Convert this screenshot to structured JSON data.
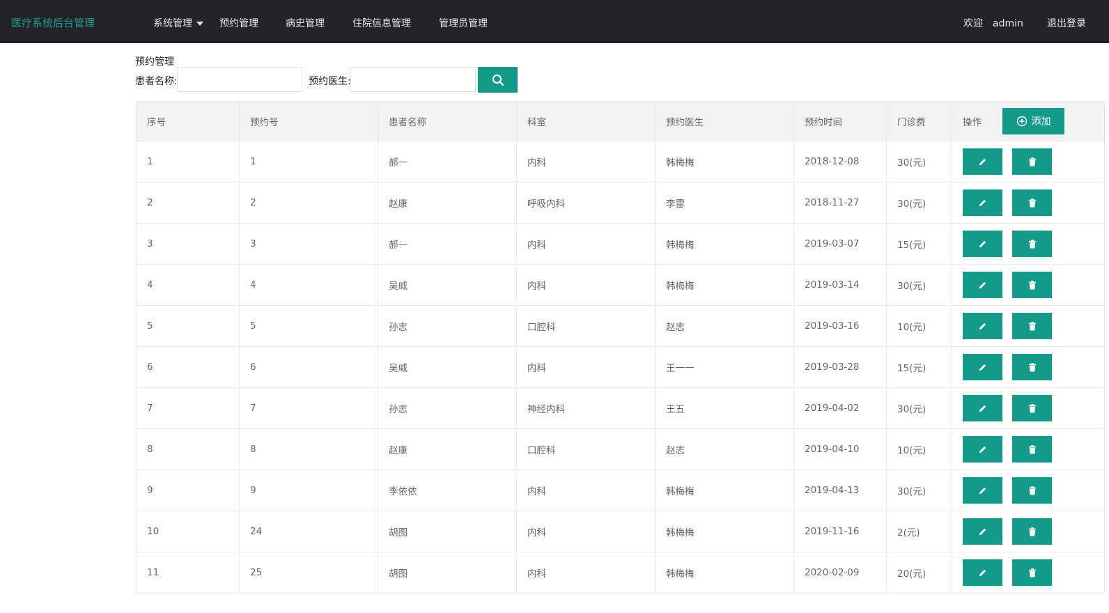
{
  "navbar": {
    "brand": "医疗系统后台管理",
    "menu": [
      {
        "label": "系统管理",
        "has_dropdown": true
      },
      {
        "label": "预约管理"
      },
      {
        "label": "病史管理"
      },
      {
        "label": "住院信息管理"
      },
      {
        "label": "管理员管理"
      }
    ],
    "welcome": "欢迎",
    "username": "admin",
    "logout": "退出登录"
  },
  "page": {
    "section_title": "预约管理",
    "filters": {
      "patient_label": "患者名称:",
      "patient_value": "",
      "doctor_label": "预约医生:",
      "doctor_value": ""
    }
  },
  "table": {
    "headers": [
      "序号",
      "预约号",
      "患者名称",
      "科室",
      "预约医生",
      "预约时间",
      "门诊费",
      "操作"
    ],
    "add_label": "添加",
    "rows": [
      [
        "1",
        "1",
        "郝一",
        "内科",
        "韩梅梅",
        "2018-12-08",
        "30(元)"
      ],
      [
        "2",
        "2",
        "赵康",
        "呼吸内科",
        "李雷",
        "2018-11-27",
        "30(元)"
      ],
      [
        "3",
        "3",
        "郝一",
        "内科",
        "韩梅梅",
        "2019-03-07",
        "15(元)"
      ],
      [
        "4",
        "4",
        "吴威",
        "内科",
        "韩梅梅",
        "2019-03-14",
        "30(元)"
      ],
      [
        "5",
        "5",
        "孙志",
        "口腔科",
        "赵志",
        "2019-03-16",
        "10(元)"
      ],
      [
        "6",
        "6",
        "吴威",
        "内科",
        "王一一",
        "2019-03-28",
        "15(元)"
      ],
      [
        "7",
        "7",
        "孙志",
        "神经内科",
        "王五",
        "2019-04-02",
        "30(元)"
      ],
      [
        "8",
        "8",
        "赵康",
        "口腔科",
        "赵志",
        "2019-04-10",
        "10(元)"
      ],
      [
        "9",
        "9",
        "李依依",
        "内科",
        "韩梅梅",
        "2019-04-13",
        "30(元)"
      ],
      [
        "10",
        "24",
        "胡图",
        "内科",
        "韩梅梅",
        "2019-11-16",
        "2(元)"
      ],
      [
        "11",
        "25",
        "胡图",
        "内科",
        "韩梅梅",
        "2020-02-09",
        "20(元)"
      ]
    ]
  },
  "icons": {
    "search": "search-icon",
    "add": "plus-circle-icon",
    "edit": "pencil-icon",
    "delete": "trash-icon"
  },
  "colors": {
    "navbar_bg": "#222428",
    "brand": "#1e9e8f",
    "accent": "#139a8a",
    "header_row_bg": "#f2f2f2"
  }
}
